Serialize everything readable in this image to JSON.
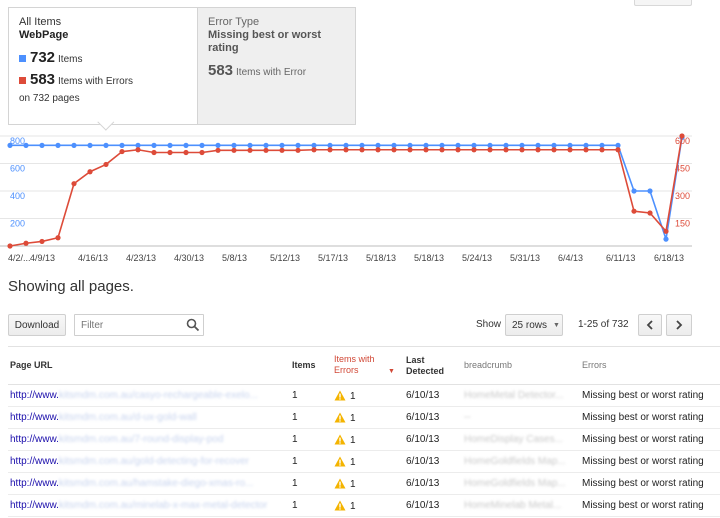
{
  "summary": {
    "selected": {
      "category": "All Items",
      "name": "WebPage",
      "items_count": "732",
      "items_label": "Items",
      "errors_count": "583",
      "errors_label": "Items with Errors",
      "pages_note": "on 732 pages"
    },
    "other": {
      "category": "Error Type",
      "name": "Missing best or worst rating",
      "count": "583",
      "label": "Items with Error"
    }
  },
  "colors": {
    "items_blue": "#4d90fe",
    "errors_red": "#dd4b39"
  },
  "chart_data": {
    "type": "line",
    "x": [
      "4/2/...",
      "",
      "4/9/13",
      "",
      "",
      "4/16/13",
      "",
      "",
      "4/23/13",
      "",
      "",
      "4/30/13",
      "",
      "",
      "5/8/13",
      "",
      "",
      "5/12/13",
      "",
      "",
      "5/17/13",
      "",
      "",
      "5/18/13",
      "",
      "",
      "5/18/13",
      "",
      "",
      "5/24/13",
      "",
      "",
      "5/31/13",
      "",
      "",
      "6/4/13",
      "",
      "",
      "6/11/13",
      "",
      "",
      "6/18/13",
      ""
    ],
    "x_tick_labels": [
      "4/2/...",
      "4/9/13",
      "4/16/13",
      "4/23/13",
      "4/30/13",
      "5/8/13",
      "5/12/13",
      "5/17/13",
      "5/18/13",
      "5/18/13",
      "5/24/13",
      "5/31/13",
      "6/4/13",
      "6/11/13",
      "6/18/13"
    ],
    "series": [
      {
        "axis": "left",
        "color": "#4d90fe",
        "values": [
          732,
          732,
          732,
          732,
          732,
          732,
          732,
          732,
          732,
          732,
          732,
          732,
          732,
          732,
          732,
          732,
          732,
          732,
          732,
          732,
          732,
          732,
          732,
          732,
          732,
          732,
          732,
          732,
          732,
          732,
          732,
          732,
          732,
          732,
          732,
          732,
          732,
          732,
          732,
          400,
          400,
          50,
          790
        ]
      },
      {
        "axis": "right",
        "color": "#dd4b39",
        "values": [
          0,
          15,
          25,
          45,
          340,
          405,
          445,
          515,
          525,
          510,
          510,
          510,
          510,
          522,
          522,
          522,
          522,
          522,
          522,
          525,
          525,
          525,
          525,
          525,
          525,
          525,
          525,
          525,
          525,
          525,
          525,
          525,
          525,
          525,
          525,
          525,
          525,
          525,
          525,
          190,
          180,
          80,
          600
        ]
      }
    ],
    "y_left_ticks": [
      200,
      400,
      600,
      800
    ],
    "y_right_ticks": [
      150,
      300,
      450,
      600
    ],
    "y_left_range": [
      0,
      800
    ],
    "y_right_range": [
      0,
      600
    ],
    "grid": true
  },
  "showing_text": "Showing all pages.",
  "toolbar": {
    "download_label": "Download",
    "filter_placeholder": "Filter",
    "show_label": "Show",
    "rows_value": "25 rows",
    "pager_text": "1-25 of 732"
  },
  "table": {
    "headers": {
      "url": "Page URL",
      "items": "Items",
      "errors": "Items with Errors",
      "detected": "Last Detected",
      "breadcrumb": "breadcrumb",
      "error_col": "Errors"
    },
    "rows": [
      {
        "url_prefix": "http://www.",
        "url_rest": "kitsmdm.com.au/casyo-rechargeable-exelo...",
        "items": "1",
        "errors": "1",
        "detected": "6/10/13",
        "breadcrumb": "HomeMetal Detector...",
        "error": "Missing best or worst rating"
      },
      {
        "url_prefix": "http://www.",
        "url_rest": "kitsmdm.com.au/d-ux-gold-wall",
        "items": "1",
        "errors": "1",
        "detected": "6/10/13",
        "breadcrumb": "--",
        "error": "Missing best or worst rating"
      },
      {
        "url_prefix": "http://www.",
        "url_rest": "kitsmdm.com.au/7-round-display-pod",
        "items": "1",
        "errors": "1",
        "detected": "6/10/13",
        "breadcrumb": "HomeDisplay Cases...",
        "error": "Missing best or worst rating"
      },
      {
        "url_prefix": "http://www.",
        "url_rest": "kitsmdm.com.au/gold-detecting-for-recover",
        "items": "1",
        "errors": "1",
        "detected": "6/10/13",
        "breadcrumb": "HomeGoldfields Map...",
        "error": "Missing best or worst rating"
      },
      {
        "url_prefix": "http://www.",
        "url_rest": "kitsmdm.com.au/hamstake-diego-xmas-ro...",
        "items": "1",
        "errors": "1",
        "detected": "6/10/13",
        "breadcrumb": "HomeGoldfields Map...",
        "error": "Missing best or worst rating"
      },
      {
        "url_prefix": "http://www.",
        "url_rest": "kitsmdm.com.au/minelab-x-max-metal-detector",
        "items": "1",
        "errors": "1",
        "detected": "6/10/13",
        "breadcrumb": "HomeMinelab Metal...",
        "error": "Missing best or worst rating"
      }
    ]
  }
}
